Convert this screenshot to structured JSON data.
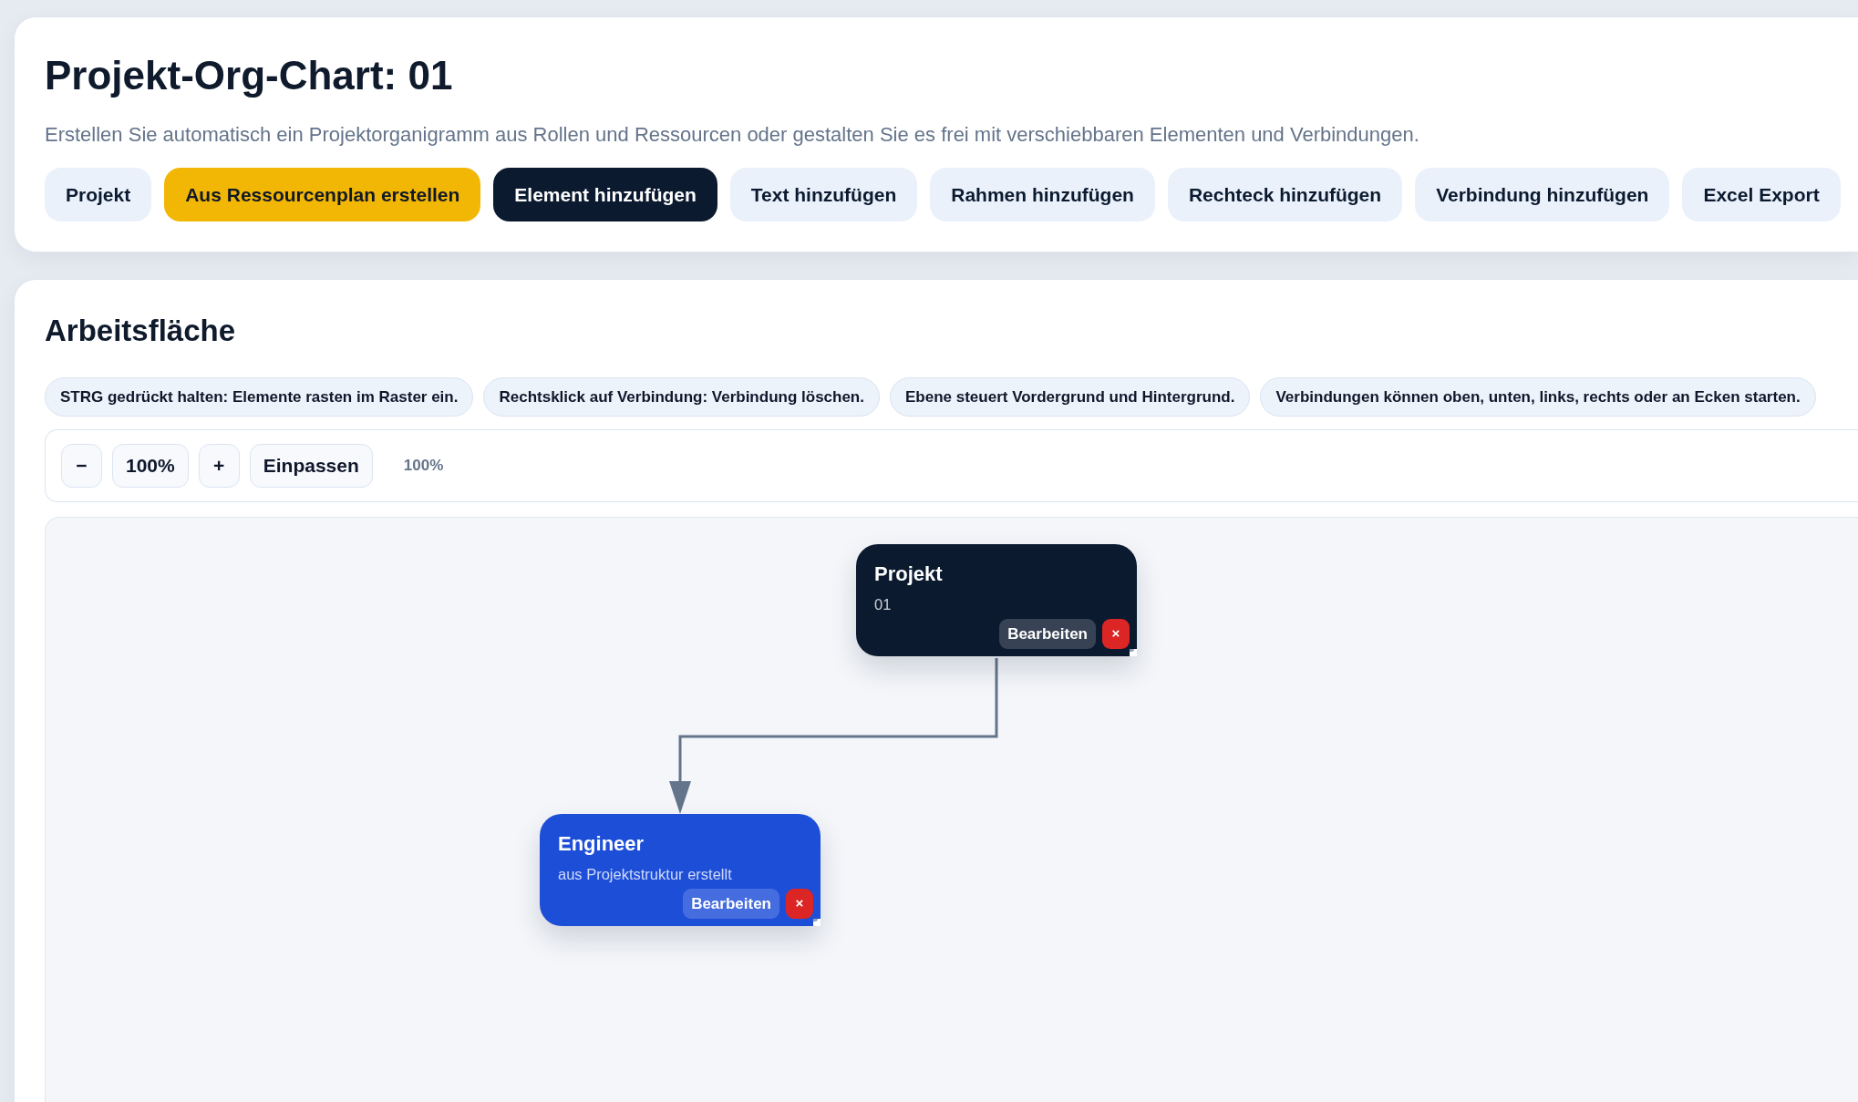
{
  "header": {
    "title": "Projekt-Org-Chart: 01",
    "description": "Erstellen Sie automatisch ein Projektorganigramm aus Rollen und Ressourcen oder gestalten Sie es frei mit verschiebbaren Elementen und Verbindungen.",
    "buttons": [
      {
        "label": "Projekt",
        "kind": "light"
      },
      {
        "label": "Aus Ressourcenplan erstellen",
        "kind": "accent"
      },
      {
        "label": "Element hinzufügen",
        "kind": "dark"
      },
      {
        "label": "Text hinzufügen",
        "kind": "light"
      },
      {
        "label": "Rahmen hinzufügen",
        "kind": "light"
      },
      {
        "label": "Rechteck hinzufügen",
        "kind": "light"
      },
      {
        "label": "Verbindung hinzufügen",
        "kind": "light"
      },
      {
        "label": "Excel Export",
        "kind": "light"
      }
    ]
  },
  "workspace": {
    "title": "Arbeitsfläche",
    "hints": [
      "STRG gedrückt halten: Elemente rasten im Raster ein.",
      "Rechtsklick auf Verbindung: Verbindung löschen.",
      "Ebene steuert Vordergrund und Hintergrund.",
      "Verbindungen können oben, unten, links, rechts oder an Ecken starten."
    ],
    "zoom_toolbar": {
      "buttons": [
        "−",
        "100%",
        "+",
        "Einpassen"
      ],
      "zoom_level": "100%"
    },
    "canvas": {
      "nodes": [
        {
          "title": "Projekt",
          "subtitle": "01",
          "color": "#0b1a2f",
          "edit_label": "Bearbeiten",
          "delete_label": "×",
          "children": [
            {
              "title": "Engineer",
              "subtitle": "aus Projektstruktur erstellt",
              "color": "#1d4ed8",
              "edit_label": "Bearbeiten",
              "delete_label": "×"
            }
          ]
        }
      ]
    }
  }
}
